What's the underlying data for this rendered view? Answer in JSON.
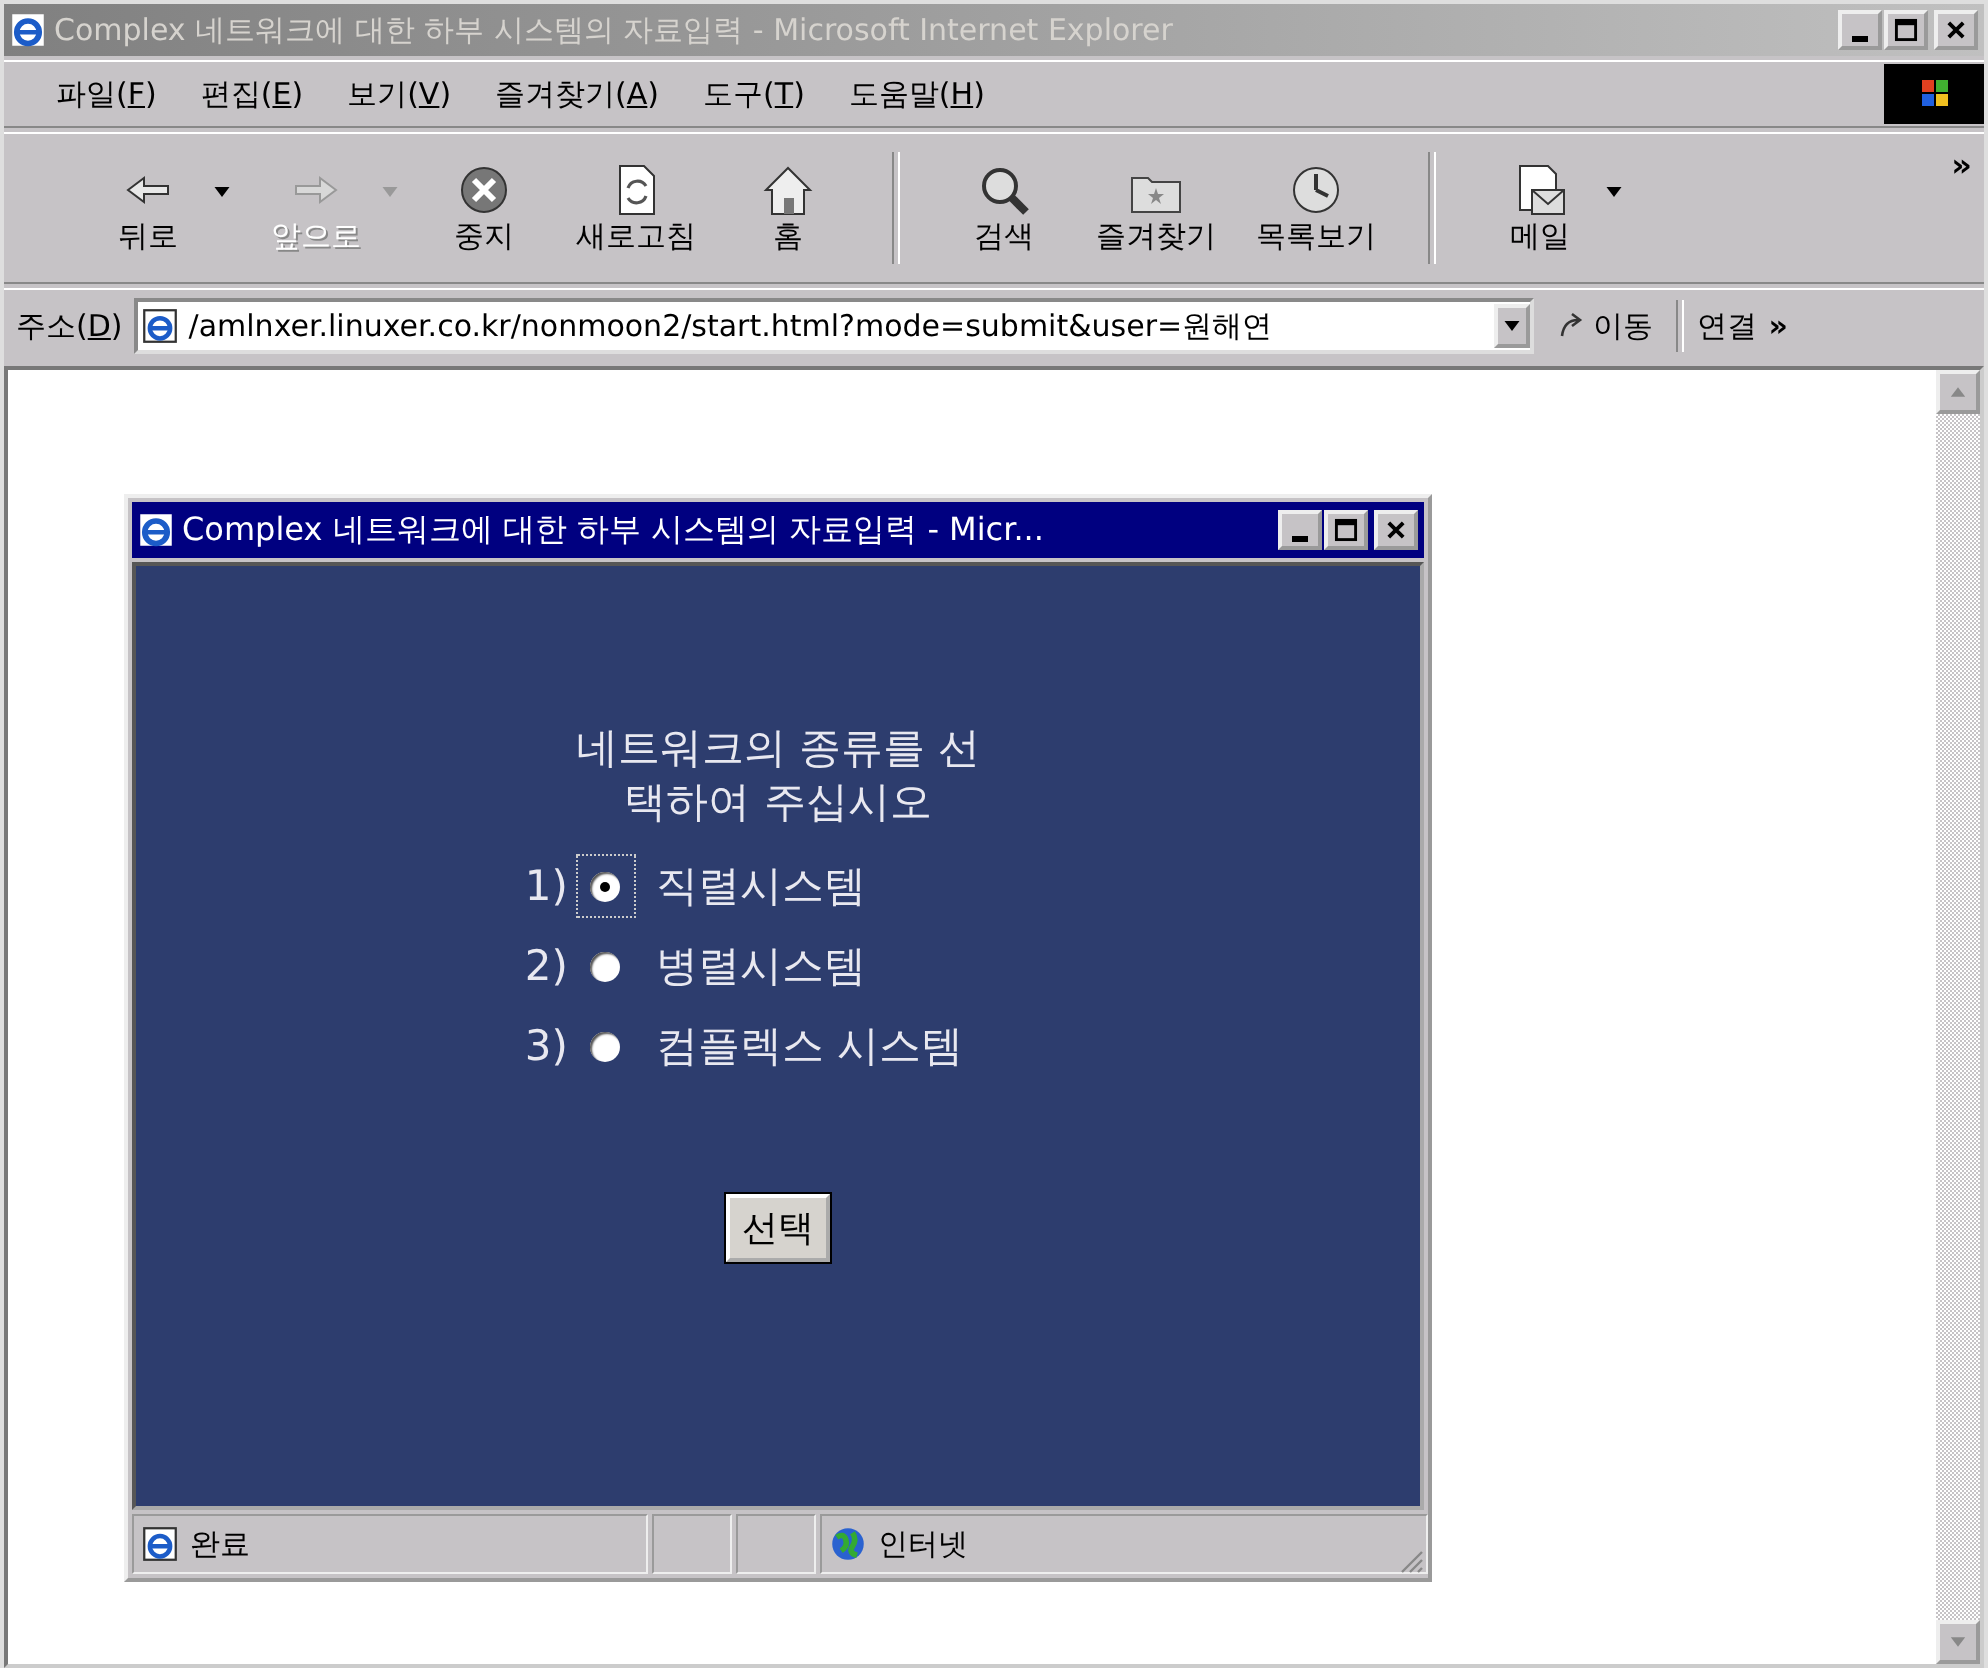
{
  "window": {
    "title": "Complex 네트워크에 대한 하부 시스템의 자료입력 - Microsoft Internet Explorer",
    "active": false
  },
  "menu": [
    {
      "before": "파일(",
      "key": "F",
      "after": ")"
    },
    {
      "before": "편집(",
      "key": "E",
      "after": ")"
    },
    {
      "before": "보기(",
      "key": "V",
      "after": ")"
    },
    {
      "before": "즐겨찾기(",
      "key": "A",
      "after": ")"
    },
    {
      "before": "도구(",
      "key": "T",
      "after": ")"
    },
    {
      "before": "도움말(",
      "key": "H",
      "after": ")"
    }
  ],
  "toolbar": {
    "groups": [
      [
        {
          "kind": "back",
          "label": "뒤로",
          "disabled": false,
          "dropdown": true
        },
        {
          "kind": "forward",
          "label": "앞으로",
          "disabled": true,
          "dropdown": true
        },
        {
          "kind": "stop",
          "label": "중지",
          "disabled": false,
          "dropdown": false
        },
        {
          "kind": "refresh",
          "label": "새로고침",
          "disabled": false,
          "dropdown": false
        },
        {
          "kind": "home",
          "label": "홈",
          "disabled": false,
          "dropdown": false
        }
      ],
      [
        {
          "kind": "search",
          "label": "검색",
          "disabled": false,
          "dropdown": false
        },
        {
          "kind": "favorites",
          "label": "즐겨찾기",
          "disabled": false,
          "dropdown": false
        },
        {
          "kind": "history",
          "label": "목록보기",
          "disabled": false,
          "dropdown": false
        }
      ],
      [
        {
          "kind": "mail",
          "label": "메일",
          "disabled": false,
          "dropdown": true
        }
      ]
    ],
    "more": "»"
  },
  "address": {
    "before": "주소(",
    "key": "D",
    "after": ")",
    "value": "/amlnxer.linuxer.co.kr/nonmoon2/start.html?mode=submit&user=원해연",
    "go": "이동",
    "links": "연결",
    "links_more": "»"
  },
  "popup": {
    "title": "Complex 네트워크에 대한 하부 시스템의 자료입력 - Micr...",
    "active": true,
    "prompt_lines": [
      "네트워크의 종류를 선",
      "택하여 주십시오"
    ],
    "options": [
      {
        "number": "1)",
        "label": "직렬시스템",
        "selected": true,
        "focused": true
      },
      {
        "number": "2)",
        "label": "병렬시스템",
        "selected": false,
        "focused": false
      },
      {
        "number": "3)",
        "label": "컴플렉스 시스템",
        "selected": false,
        "focused": false
      }
    ],
    "button": "선택",
    "status": {
      "text": "완료",
      "zone": "인터넷"
    }
  }
}
